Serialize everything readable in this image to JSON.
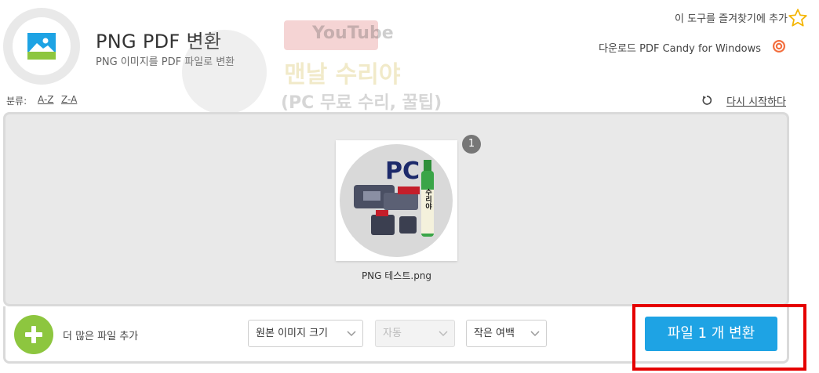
{
  "header": {
    "title": "PNG PDF 변환",
    "subtitle": "PNG 이미지를 PDF 파일로 변환",
    "app_icon": "image-icon"
  },
  "watermark": {
    "youtube_text": "YouTube",
    "line1": "맨날 수리야",
    "line2": "(PC 무료 수리, 꿀팁)"
  },
  "top_links": {
    "favorite_label": "이 도구를 즐겨찾기에 추가",
    "favorite_icon": "star-icon",
    "download_label": "다운로드 PDF Candy for Windows",
    "download_icon": "candy-icon"
  },
  "sort": {
    "label": "분류:",
    "az": "A-Z",
    "za": "Z-A"
  },
  "restart_label": "다시 시작하다",
  "files": [
    {
      "index": "1",
      "name": "PNG 테스트.png",
      "thumb_text": "PC",
      "bottle_text": "수리야"
    }
  ],
  "bottom": {
    "add_label": "더 많은 파일 추가",
    "image_size": "원본 이미지 크기",
    "orientation": "자동",
    "margin": "작은 여백",
    "convert_label": "파일 1 개 변환"
  },
  "colors": {
    "accent": "#1ea3e4",
    "add_button": "#8dc63f",
    "highlight": "#e50000",
    "panel_bg": "#e9e9e9"
  }
}
